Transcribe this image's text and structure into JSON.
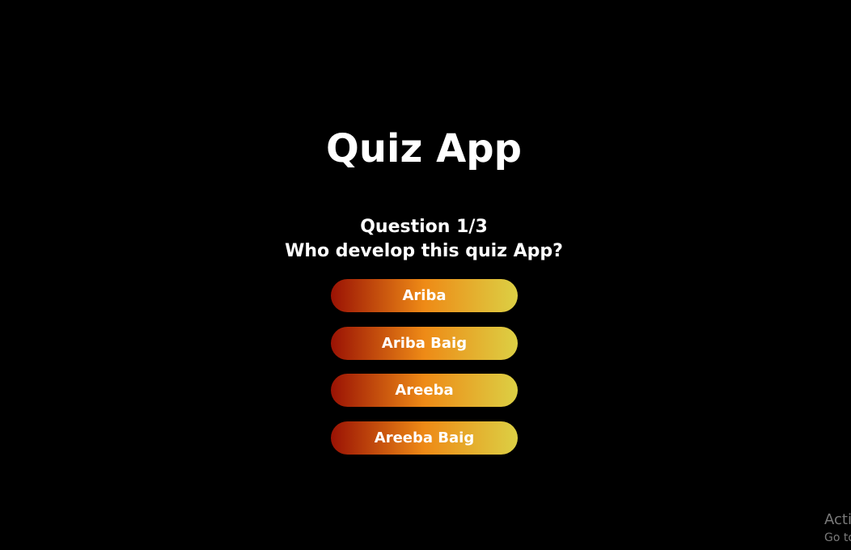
{
  "app": {
    "title": "Quiz App"
  },
  "quiz": {
    "question_counter": "Question 1/3",
    "question_text": "Who develop this quiz App?",
    "options": [
      {
        "label": "Ariba"
      },
      {
        "label": "Ariba Baig"
      },
      {
        "label": "Areeba"
      },
      {
        "label": "Areeba Baig"
      }
    ]
  },
  "theme": {
    "background": "#000000",
    "text": "#ffffff",
    "option_gradient_start": "#9a1204",
    "option_gradient_mid": "#ee8a16",
    "option_gradient_end": "#dcd044"
  },
  "watermark": {
    "line1": "Acti",
    "line2": "Go to"
  }
}
